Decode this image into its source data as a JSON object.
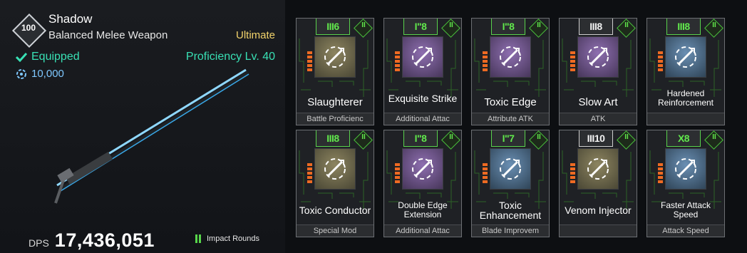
{
  "weapon": {
    "rank": "100",
    "name": "Shadow",
    "type": "Balanced Melee Weapon",
    "grade": "Ultimate",
    "status": "Equipped",
    "proficiency": "Proficiency Lv. 40",
    "price": "10,000",
    "dps_label": "DPS",
    "dps_value": "17,436,051",
    "ammo_type": "Impact Rounds"
  },
  "modules": [
    {
      "name": "Slaughterer",
      "category": "Battle Proficienc",
      "cost_label": "6",
      "cost_symbol": "III",
      "cap_color": "#61e84c",
      "connector": "II",
      "icon": "slash-arrows-icon",
      "tint": "gold"
    },
    {
      "name": "Exquisite Strike",
      "category": "Additional Attac",
      "cost_label": "8",
      "cost_symbol": "I\"",
      "cap_color": "#61e84c",
      "connector": "II",
      "icon": "cross-arrows-icon",
      "tint": "purple"
    },
    {
      "name": "Toxic Edge",
      "category": "Attribute ATK",
      "cost_label": "8",
      "cost_symbol": "I\"",
      "cap_color": "#61e84c",
      "connector": "II",
      "icon": "toxic-blade-icon",
      "tint": "purple"
    },
    {
      "name": "Slow Art",
      "category": "ATK",
      "cost_label": "8",
      "cost_symbol": "III",
      "cap_color": "#f2f2f2",
      "connector": "II",
      "icon": "circular-arrows-icon",
      "tint": "purple"
    },
    {
      "name": "Hardened Reinforcement",
      "category": "",
      "cost_label": "8",
      "cost_symbol": "III",
      "cap_color": "#61e84c",
      "connector": "II",
      "icon": "sword-up-icon",
      "tint": "blue"
    },
    {
      "name": "Toxic Conductor",
      "category": "Special Mod",
      "cost_label": "8",
      "cost_symbol": "III",
      "cap_color": "#61e84c",
      "connector": "II",
      "icon": "toxic-skull-icon",
      "tint": "gold"
    },
    {
      "name": "Double Edge Extension",
      "category": "Additional Attac",
      "cost_label": "8",
      "cost_symbol": "I\"",
      "cap_color": "#61e84c",
      "connector": "II",
      "icon": "double-blade-icon",
      "tint": "purple"
    },
    {
      "name": "Toxic Enhancement",
      "category": "Blade Improvem",
      "cost_label": "7",
      "cost_symbol": "I\"",
      "cap_color": "#61e84c",
      "connector": "II",
      "icon": "skull-sword-icon",
      "tint": "blue"
    },
    {
      "name": "Venom Injector",
      "category": "",
      "cost_label": "10",
      "cost_symbol": "III",
      "cap_color": "#f2f2f2",
      "connector": "II",
      "icon": "venom-slash-icon",
      "tint": "gold"
    },
    {
      "name": "Faster Attack Speed",
      "category": "Attack Speed",
      "cost_label": "8",
      "cost_symbol": "X",
      "cap_color": "#61e84c",
      "connector": "II",
      "icon": "fast-sword-icon",
      "tint": "blue"
    }
  ],
  "colors": {
    "accent_green": "#38e0b4",
    "grade_gold": "#f2d36b",
    "cap_green": "#61e84c",
    "cost_orange": "#ee6a22"
  }
}
